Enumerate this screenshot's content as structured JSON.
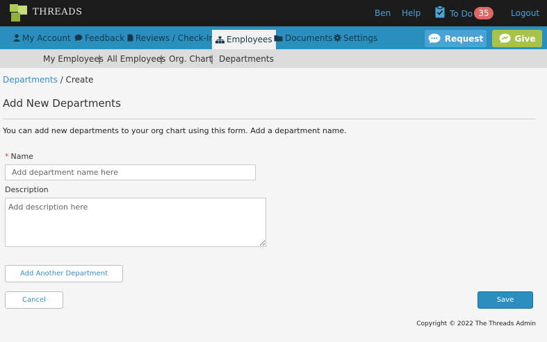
{
  "header": {
    "logo_text": "THREADS",
    "user_label": "Ben",
    "help_label": "Help",
    "todo_label": "To Do",
    "todo_count": "35",
    "logout_label": "Logout"
  },
  "nav": {
    "items": [
      {
        "label": "My Account",
        "icon": "person-icon"
      },
      {
        "label": "Feedback",
        "icon": "chat-icon"
      },
      {
        "label": "Reviews / Check-Ins",
        "icon": "document-icon"
      },
      {
        "label": "Employees",
        "icon": "org-chart-icon"
      },
      {
        "label": "Documents",
        "icon": "folder-icon"
      },
      {
        "label": "Settings",
        "icon": "gear-icon"
      }
    ],
    "active": "Employees",
    "request_label": "Request",
    "give_label": "Give",
    "colors": {
      "bar": "#2a8fbf",
      "request": "#4aa3d6",
      "give": "#a8c24a"
    }
  },
  "subnav": {
    "items": [
      "My Employees",
      "All Employees",
      "Org. Chart",
      "Departments"
    ],
    "separator": "|"
  },
  "breadcrumb": {
    "link": "Departments",
    "current": "/ Create"
  },
  "page": {
    "title": "Add New Departments",
    "intro": "You can add new departments to your org chart using this form. Add a department name."
  },
  "form": {
    "required_mark": "*",
    "name_label": "Name",
    "name_value": "",
    "name_placeholder": "Add department name here",
    "description_label": "Description",
    "description_value": "",
    "description_placeholder": "Add description here",
    "add_another_label": "Add Another Department",
    "cancel_label": "Cancel",
    "save_label": "Save"
  },
  "footer": {
    "copyright": "Copyright © 2022 The Threads Admin"
  }
}
